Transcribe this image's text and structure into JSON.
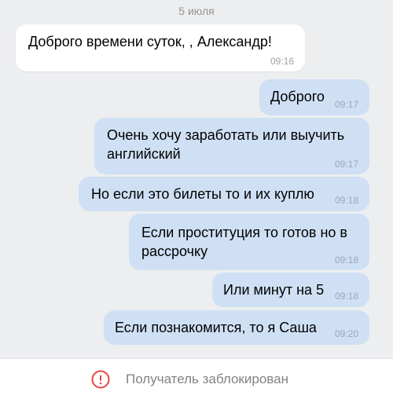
{
  "chat": {
    "date_separator": "5 июля",
    "messages": [
      {
        "direction": "incoming",
        "text": "Доброго времени суток, , Александр!",
        "time": "09:16"
      },
      {
        "direction": "outgoing",
        "text": "Доброго",
        "time": "09:17"
      },
      {
        "direction": "outgoing",
        "text": "Очень хочу заработать или выучить английский",
        "time": "09:17"
      },
      {
        "direction": "outgoing",
        "text": "Но если это билеты то и их куплю",
        "time": "09:18"
      },
      {
        "direction": "outgoing",
        "text": "Если проституция то готов но в рассрочку",
        "time": "09:18"
      },
      {
        "direction": "outgoing",
        "text": "Или минут на 5",
        "time": "09:18"
      },
      {
        "direction": "outgoing",
        "text": "Если познакомится, то я Саша",
        "time": "09:20"
      }
    ]
  },
  "footer": {
    "icon": "alert-circle-icon",
    "status_text": "Получатель заблокирован"
  },
  "colors": {
    "background": "#edeef0",
    "incoming_bubble": "#ffffff",
    "outgoing_bubble": "#cfe0f4",
    "alert_red": "#e64646"
  }
}
